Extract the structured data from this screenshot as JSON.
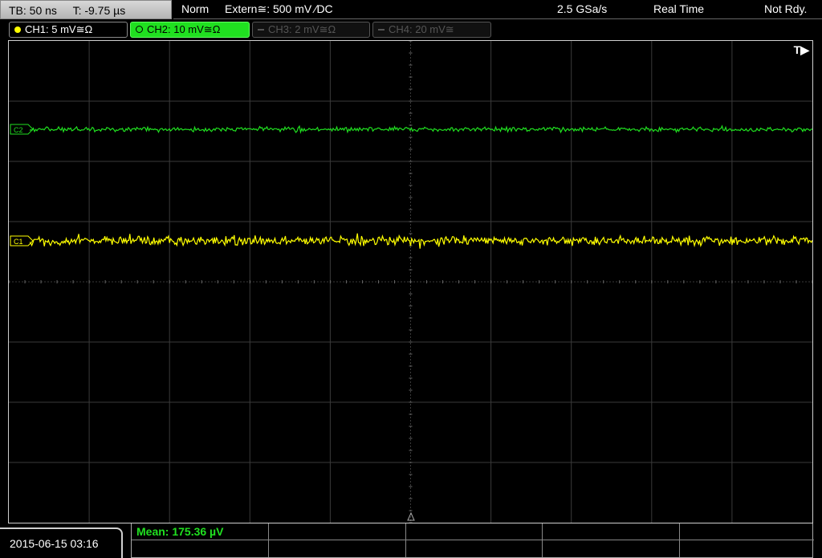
{
  "timebase": {
    "tb_label": "TB: 50 ns",
    "trigger_time": "T: -9.75 µs"
  },
  "status": {
    "mode": "Norm",
    "trigger_source": "Extern≅: 500 mV ∕DC",
    "sample_rate": "2.5 GSa/s",
    "acq_mode": "Real Time",
    "ready_state": "Not Rdy."
  },
  "channels": [
    {
      "label": "CH1: 5 mV≅Ω",
      "color": "#ffff00",
      "active": true
    },
    {
      "label": "CH2: 10 mV≅Ω",
      "color": "#20e020",
      "active": true,
      "selected": true
    },
    {
      "label": "CH3: 2 mV≅Ω",
      "color": "#555555",
      "active": false
    },
    {
      "label": "CH4: 20 mV≅",
      "color": "#555555",
      "active": false
    }
  ],
  "screen": {
    "trigger_position_marker": "T▶",
    "ch1_marker": "C1",
    "ch2_marker": "C2"
  },
  "datetime": "2015-06-15 03:16",
  "measurement": {
    "mean": "Mean: 175.36 µV"
  },
  "colors": {
    "ch1": "#ffff00",
    "ch2": "#20e020",
    "grid": "#3a3a3a",
    "frame": "#cfcfcf"
  }
}
